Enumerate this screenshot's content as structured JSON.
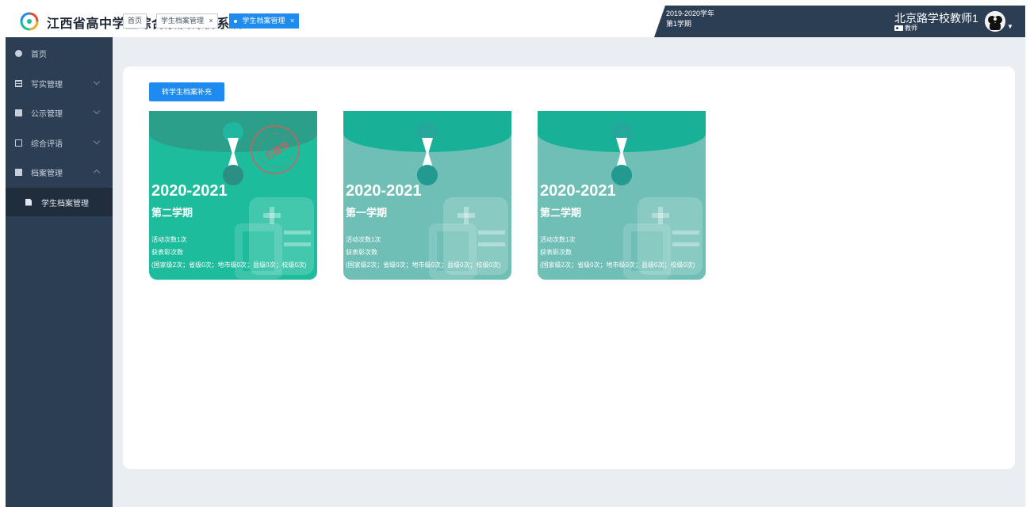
{
  "header": {
    "title": "江西省高中学生综合素质评价系统",
    "term_year": "2019-2020学年",
    "term_semester": "第1学期",
    "user_name": "北京路学校教师1",
    "user_role": "教师"
  },
  "sidebar": {
    "items": [
      {
        "label": "首页"
      },
      {
        "label": "写实管理"
      },
      {
        "label": "公示管理"
      },
      {
        "label": "综合评语"
      },
      {
        "label": "档案管理"
      }
    ],
    "sub_item": "学生档案管理"
  },
  "tabs": [
    {
      "label": "首页"
    },
    {
      "label": "学生档案管理"
    },
    {
      "label": "学生档案管理"
    }
  ],
  "tab_close_symbol": "×",
  "main": {
    "button_label": "转学生档案补充",
    "cards": [
      {
        "year": "2020-2021",
        "semester": "第二学期",
        "activity": "活动次数1次",
        "award_title": "获表彰次数",
        "award_detail": "(国家级2次；省级0次；地市级0次；县级0次；校级0次)",
        "stamp": "已提交"
      },
      {
        "year": "2020-2021",
        "semester": "第一学期",
        "activity": "活动次数1次",
        "award_title": "获表彰次数",
        "award_detail": "(国家级2次；省级0次；地市级0次；县级0次；校级0次)"
      },
      {
        "year": "2020-2021",
        "semester": "第二学期",
        "activity": "活动次数1次",
        "award_title": "获表彰次数",
        "award_detail": "(国家级2次；省级0次；地市级0次；县级0次；校级0次)"
      }
    ]
  },
  "colors": {
    "sidebar_bg": "#2c3e54",
    "accent_blue": "#1e8bf0",
    "card_active": "#1cbc9c",
    "card_inactive": "#6fbfb6"
  }
}
